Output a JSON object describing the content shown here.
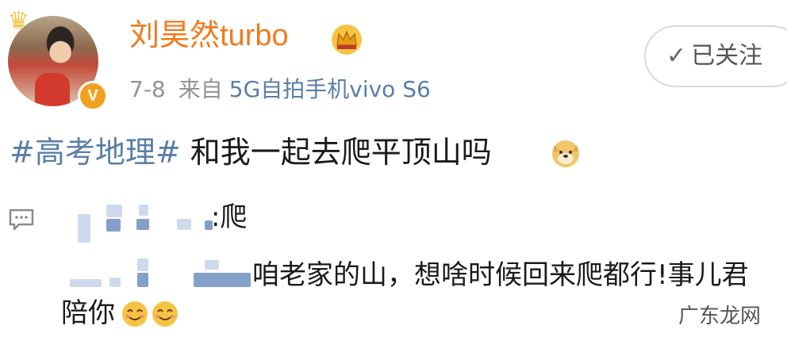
{
  "post": {
    "username": "刘昊然turbo",
    "date": "7-8",
    "from_label": "来自",
    "device": "5G自拍手机vivo S6",
    "follow_label": "已关注",
    "topic": "#高考地理#",
    "body": "和我一起去爬平顶山吗"
  },
  "comment_1": {
    "text_tail": ":爬"
  },
  "comment_2": {
    "text_line1": "咱老家的山，想啥时候回来爬都行!事儿君",
    "text_line2": "陪你"
  },
  "watermark": "广东龙网",
  "icons": {
    "crown": "crown-icon",
    "verified": "verified-v-icon",
    "check": "check-icon",
    "comment": "comment-icon",
    "doge": "doge-emoji",
    "smile": "smile-emoji"
  },
  "colors": {
    "username": "#f07b1e",
    "link": "#5a7ea8",
    "meta": "#939393"
  }
}
